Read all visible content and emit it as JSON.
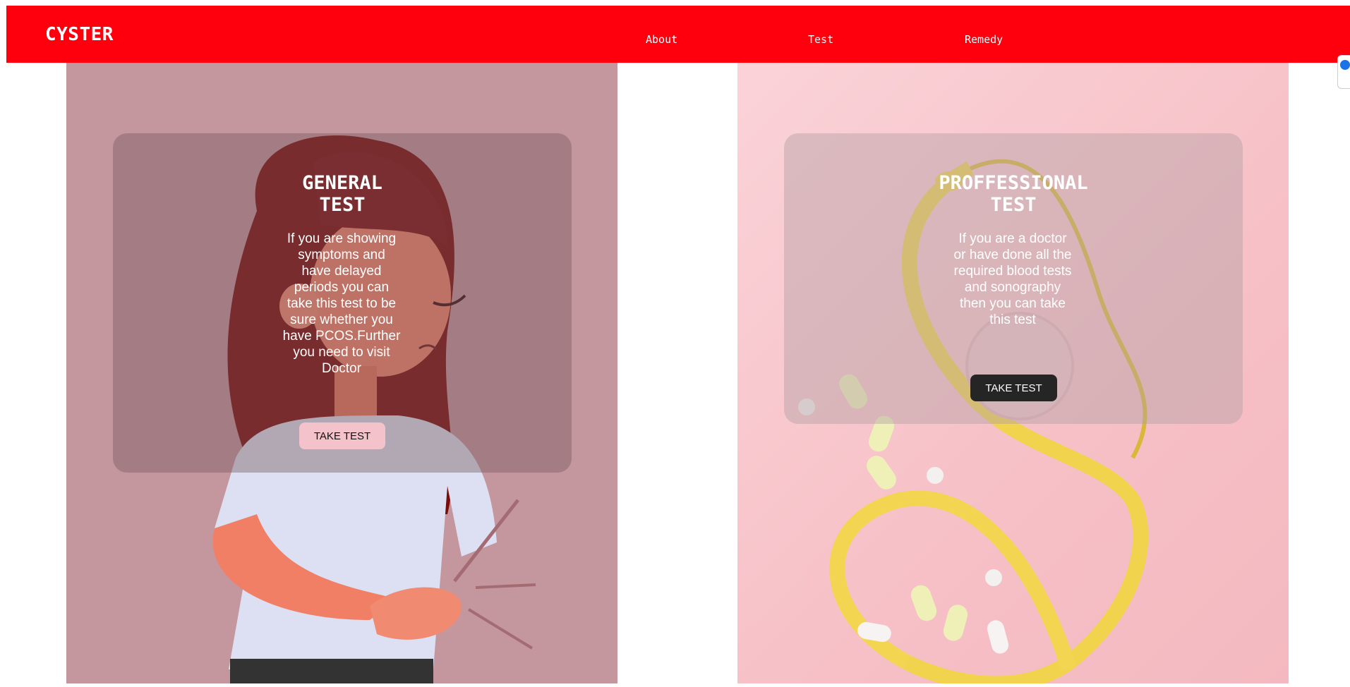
{
  "nav": {
    "brand": "CYSTER",
    "links": [
      "About",
      "Test",
      "Remedy"
    ]
  },
  "cards": {
    "general": {
      "title": "GENERAL\nTEST",
      "text": "If you are showing symptoms and have delayed periods you can take this test to be sure whether you have PCOS.Further you need to visit Doctor",
      "button": "TAKE TEST"
    },
    "professional": {
      "title": "PROFFESSIONAL\nTEST",
      "text": "If you are a doctor or have done all the required blood tests and sonography then you can take this test",
      "button": "TAKE TEST"
    }
  },
  "colors": {
    "nav_bg": "#fe000d",
    "left_panel_bg": "#c4979f",
    "right_panel_bg": "#f6c0c6",
    "general_button": "#f4c2cb",
    "professional_button": "#252525"
  }
}
